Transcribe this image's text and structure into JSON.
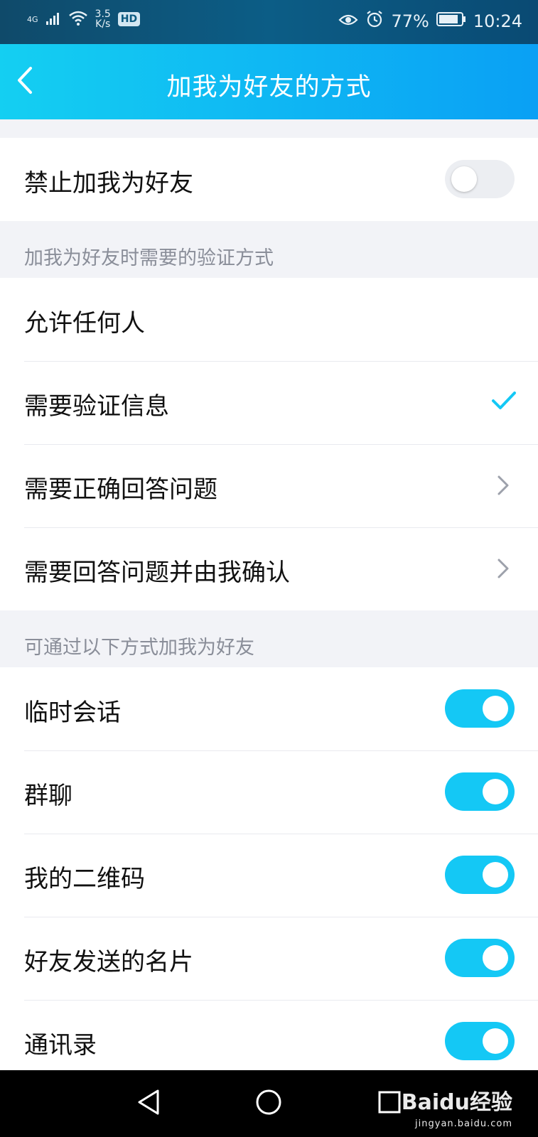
{
  "status_bar": {
    "network": "4G",
    "speed_value": "3.5",
    "speed_unit": "K/s",
    "hd": "HD",
    "battery": "77%",
    "time": "10:24"
  },
  "header": {
    "title": "加我为好友的方式"
  },
  "block_row": {
    "label": "禁止加我为好友",
    "enabled": false
  },
  "verification": {
    "header": "加我为好友时需要的验证方式",
    "options": [
      {
        "label": "允许任何人"
      },
      {
        "label": "需要验证信息",
        "selected": true
      },
      {
        "label": "需要正确回答问题"
      },
      {
        "label": "需要回答问题并由我确认"
      }
    ]
  },
  "methods": {
    "header": "可通过以下方式加我为好友",
    "items": [
      {
        "label": "临时会话",
        "enabled": true
      },
      {
        "label": "群聊",
        "enabled": true
      },
      {
        "label": "我的二维码",
        "enabled": true
      },
      {
        "label": "好友发送的名片",
        "enabled": true
      },
      {
        "label": "通讯录",
        "enabled": true
      }
    ]
  },
  "watermark": {
    "text": "Baidu经验",
    "sub": "jingyan.baidu.com"
  },
  "colors": {
    "accent": "#14c8f5",
    "header_start": "#14cff2",
    "header_end": "#0aa0f4"
  }
}
